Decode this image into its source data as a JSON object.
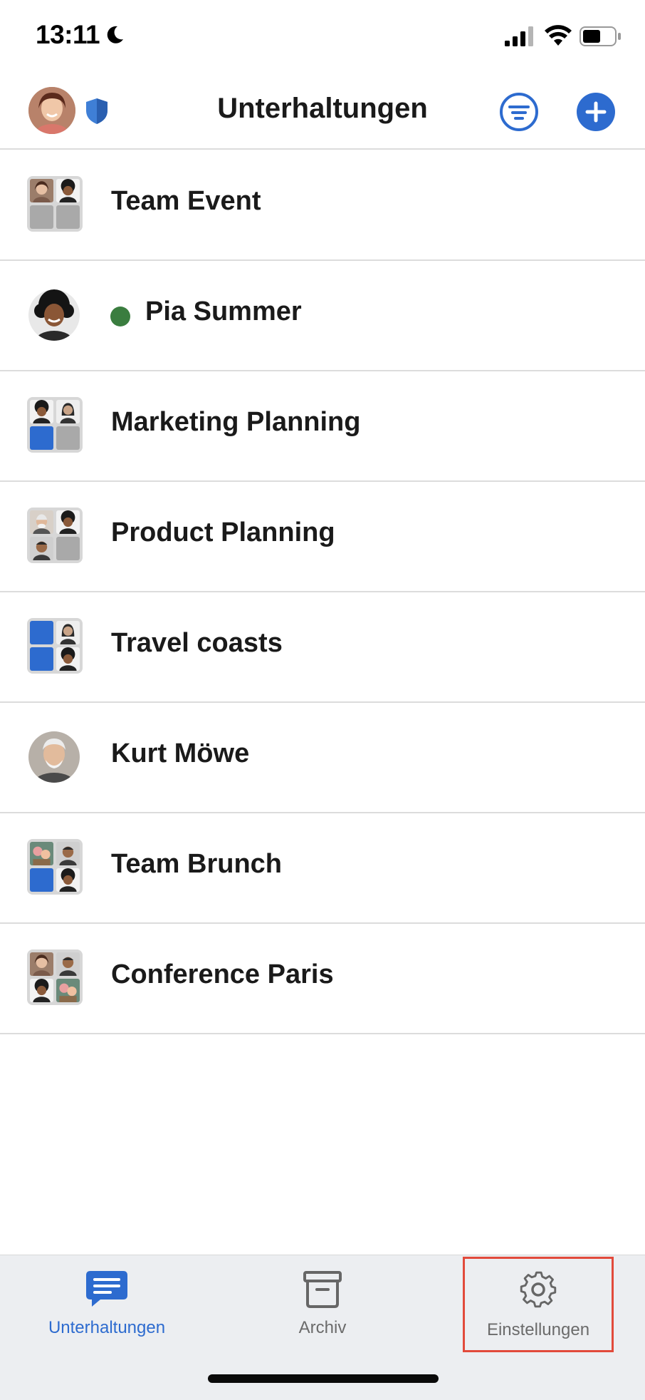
{
  "status_bar": {
    "time": "13:11",
    "icons": [
      "moon-icon",
      "signal-icon",
      "wifi-icon",
      "battery-icon"
    ]
  },
  "header": {
    "title": "Unterhaltungen",
    "avatar_icon": "user-avatar",
    "shield_icon": "shield-icon",
    "filter_icon": "filter-icon",
    "add_icon": "plus-icon"
  },
  "conversations": [
    {
      "name": "Team Event",
      "type": "group"
    },
    {
      "name": "Pia Summer",
      "type": "person",
      "online": true
    },
    {
      "name": "Marketing Planning",
      "type": "group"
    },
    {
      "name": "Product Planning",
      "type": "group"
    },
    {
      "name": "Travel coasts",
      "type": "group"
    },
    {
      "name": "Kurt Möwe",
      "type": "person"
    },
    {
      "name": "Team Brunch",
      "type": "group"
    },
    {
      "name": "Conference Paris",
      "type": "group"
    }
  ],
  "tab_bar": {
    "tabs": [
      {
        "label": "Unterhaltungen",
        "icon": "chat-icon",
        "active": true
      },
      {
        "label": "Archiv",
        "icon": "archive-box-icon",
        "active": false
      },
      {
        "label": "Einstellungen",
        "icon": "gear-icon",
        "active": false
      }
    ]
  },
  "colors": {
    "accent": "#2d6bcf",
    "online": "#3a7d3f",
    "highlight_box": "#e24a3b",
    "tab_bar_bg": "#eceef1"
  }
}
